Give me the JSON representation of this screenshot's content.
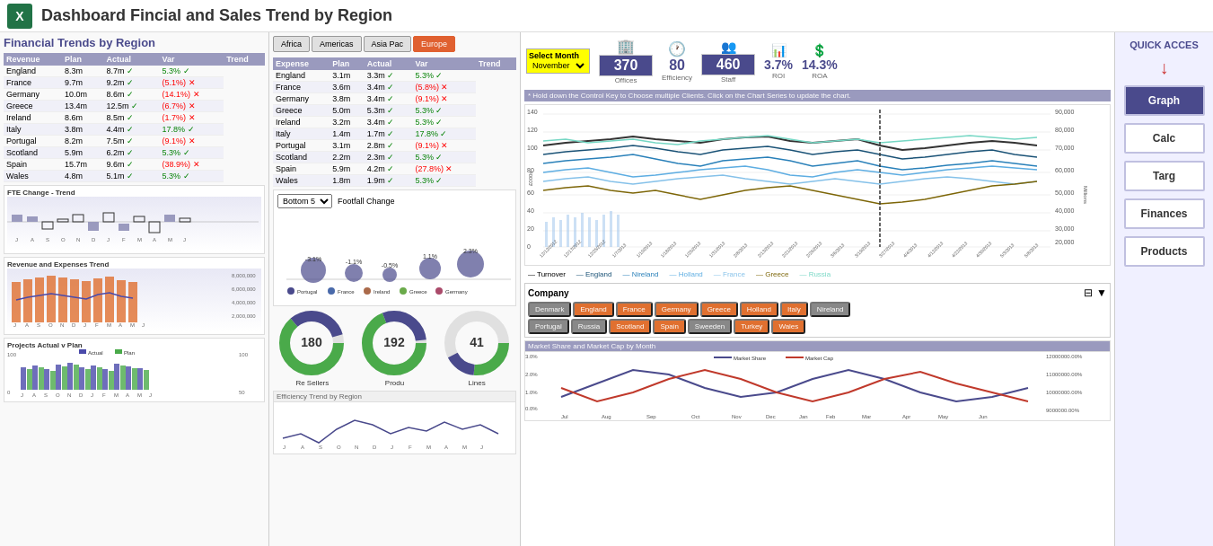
{
  "header": {
    "title": "Dashboard Fincial and Sales Trend by Region",
    "excel_label": "X"
  },
  "kpis": {
    "select_month_label": "Select Month",
    "month_value": "November",
    "offices_value": "370",
    "offices_label": "Offices",
    "efficiency_value": "80",
    "efficiency_label": "Efficiency",
    "staff_value": "460",
    "staff_label": "Staff",
    "roi_value": "3.7%",
    "roi_label": "ROI",
    "roa_value": "14.3%",
    "roa_label": "ROA"
  },
  "region_tabs": [
    "Africa",
    "Americas",
    "Asia Pac",
    "Europe"
  ],
  "active_tab": "Europe",
  "left_panel_title": "Financial Trends by Region",
  "revenue_table": {
    "headers": [
      "Revenue",
      "Plan",
      "Actual",
      "Var",
      "Trend"
    ],
    "rows": [
      [
        "England",
        "8.3m",
        "8.7m",
        "5.3%",
        "pos"
      ],
      [
        "France",
        "9.7m",
        "9.2m",
        "(5.1%)",
        "neg"
      ],
      [
        "Germany",
        "10.0m",
        "8.6m",
        "(14.1%)",
        "neg"
      ],
      [
        "Greece",
        "13.4m",
        "12.5m",
        "(6.7%)",
        "neg"
      ],
      [
        "Ireland",
        "8.6m",
        "8.5m",
        "(1.7%)",
        "neg"
      ],
      [
        "Italy",
        "3.8m",
        "4.4m",
        "17.8%",
        "pos"
      ],
      [
        "Portugal",
        "8.2m",
        "7.5m",
        "(9.1%)",
        "neg"
      ],
      [
        "Scotland",
        "5.9m",
        "6.2m",
        "5.3%",
        "pos"
      ],
      [
        "Spain",
        "15.7m",
        "9.6m",
        "(38.9%)",
        "neg"
      ],
      [
        "Wales",
        "4.8m",
        "5.1m",
        "5.3%",
        "pos"
      ]
    ]
  },
  "expense_table": {
    "headers": [
      "Expense",
      "Plan",
      "Actual",
      "Var",
      "Trend"
    ],
    "rows": [
      [
        "England",
        "3.1m",
        "3.3m",
        "5.3%",
        "pos"
      ],
      [
        "France",
        "3.6m",
        "3.4m",
        "(5.8%)",
        "neg"
      ],
      [
        "Germany",
        "3.8m",
        "3.4m",
        "(9.1%)",
        "neg"
      ],
      [
        "Greece",
        "5.0m",
        "5.3m",
        "5.3%",
        "pos"
      ],
      [
        "Ireland",
        "3.2m",
        "3.4m",
        "5.3%",
        "pos"
      ],
      [
        "Italy",
        "1.4m",
        "1.7m",
        "17.8%",
        "pos"
      ],
      [
        "Portugal",
        "3.1m",
        "2.8m",
        "(9.1%)",
        "neg"
      ],
      [
        "Scotland",
        "2.2m",
        "2.3m",
        "5.3%",
        "pos"
      ],
      [
        "Spain",
        "5.9m",
        "4.2m",
        "(27.8%)",
        "neg"
      ],
      [
        "Wales",
        "1.8m",
        "1.9m",
        "5.3%",
        "pos"
      ]
    ]
  },
  "fte_chart_title": "FTE Change - Trend",
  "revenue_expense_chart_title": "Revenue and Expenses Trend",
  "projects_chart_title": "Projects Actual v Plan",
  "bubble_chart_title": "Footfall Change",
  "bubble_filter": "Bottom 5",
  "bubble_countries": [
    "Portugal",
    "France",
    "Ireland",
    "Greece",
    "Germany"
  ],
  "bubble_values": [
    "-3.1%",
    "-1.1%",
    "-0.5%",
    "1.1%",
    "2.3%"
  ],
  "donut_data": [
    {
      "value": "180",
      "label": "Re Sellers"
    },
    {
      "value": "192",
      "label": "Produ"
    },
    {
      "value": "41",
      "label": "Lines"
    }
  ],
  "efficiency_chart_title": "Efficiency Trend by Region",
  "chart_info": "* Hold down the Control Key to Choose multiple Clients.  Click on the Chart Series to update the chart.",
  "trend_chart": {
    "y_max": 140,
    "y_min": 0,
    "y2_max": 90000,
    "legend": [
      "Turnover",
      "England",
      "Nireland",
      "Holland",
      "France",
      "Greece",
      "Russia"
    ]
  },
  "company_section": {
    "label": "Company",
    "buttons_row1": [
      "Denmark",
      "England",
      "France",
      "Germany",
      "Greece",
      "Holland",
      "Italy",
      "Nireland"
    ],
    "buttons_row2": [
      "Portugal",
      "Russia",
      "Scotland",
      "Spain",
      "Sweeden",
      "Turkey",
      "Wales"
    ],
    "active_buttons": [
      "England",
      "France",
      "Germany",
      "Greece",
      "Holland",
      "Italy",
      "Scotland",
      "Spain",
      "Wales",
      "Sweden",
      "Turkey"
    ]
  },
  "market_chart_title": "Market Share and Market Cap by Month",
  "market_legend": [
    "Market Share",
    "Market Cap"
  ],
  "quick_access": {
    "title": "QUICK ACCES",
    "buttons": [
      "Graph",
      "Calc",
      "Targ",
      "Finances",
      "Products"
    ]
  },
  "scotland_label": "scotland",
  "wales_label": "Wales",
  "greece_label_map": "Greece",
  "greece_label_table": "Greece"
}
